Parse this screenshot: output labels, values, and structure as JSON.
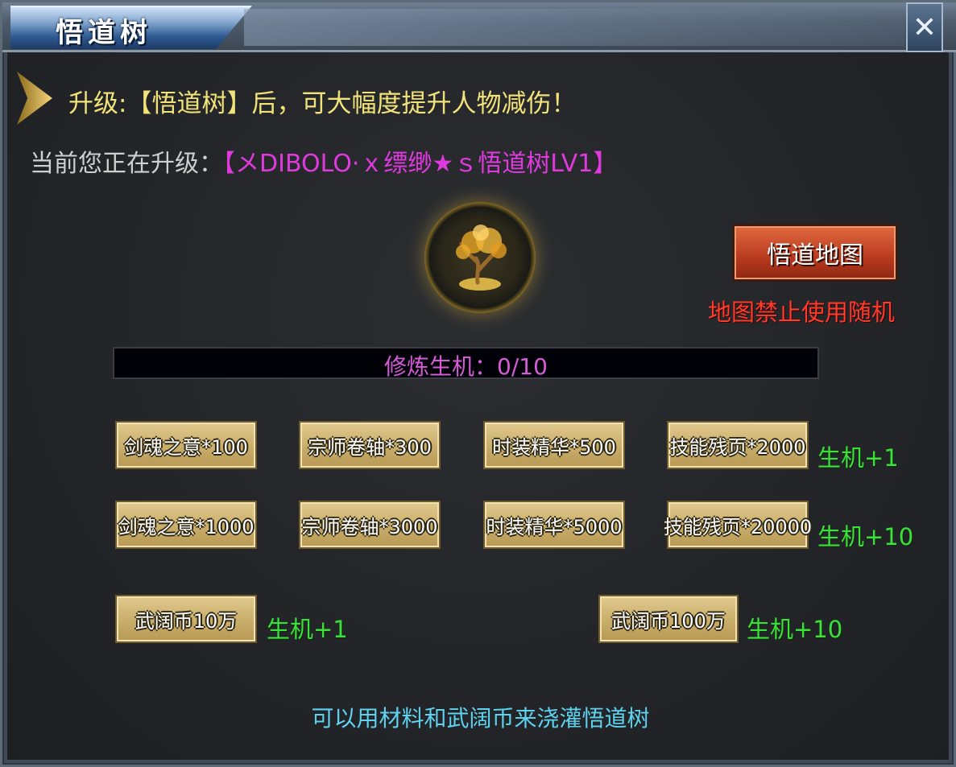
{
  "window": {
    "title": "悟道树",
    "close_label": "✕"
  },
  "info": {
    "upgrade_line": "升级:【悟道树】后，可大幅度提升人物减伤！",
    "current_prefix": "当前您正在升级：",
    "current_target": "【メDIBOLO·ｘ缥缈★ｓ悟道树LV1】"
  },
  "map": {
    "button_label": "悟道地图",
    "warning": "地图禁止使用随机"
  },
  "progress": {
    "label": "修炼生机：0/10",
    "current": 0,
    "max": 10,
    "fill_fraction": 0.0
  },
  "items": {
    "row1": [
      "剑魂之意*100",
      "宗师卷轴*300",
      "时装精华*500",
      "技能残页*2000"
    ],
    "row1_reward": "生机+1",
    "row2": [
      "剑魂之意*1000",
      "宗师卷轴*3000",
      "时装精华*5000",
      "技能残页*20000"
    ],
    "row2_reward": "生机+10",
    "coin_small": "武阔币10万",
    "coin_small_reward": "生机+1",
    "coin_large": "武阔币100万",
    "coin_large_reward": "生机+10"
  },
  "hint": "可以用材料和武阔币来浇灌悟道树",
  "icons": {
    "medallion": "golden-tree-icon",
    "arrow": "arrow-right-icon",
    "close": "close-icon"
  },
  "colors": {
    "upgrade_text": "#f1e37a",
    "player_name": "#e03adf",
    "warning": "#ff3b2a",
    "reward": "#3de03b",
    "hint": "#5fd2ef"
  }
}
